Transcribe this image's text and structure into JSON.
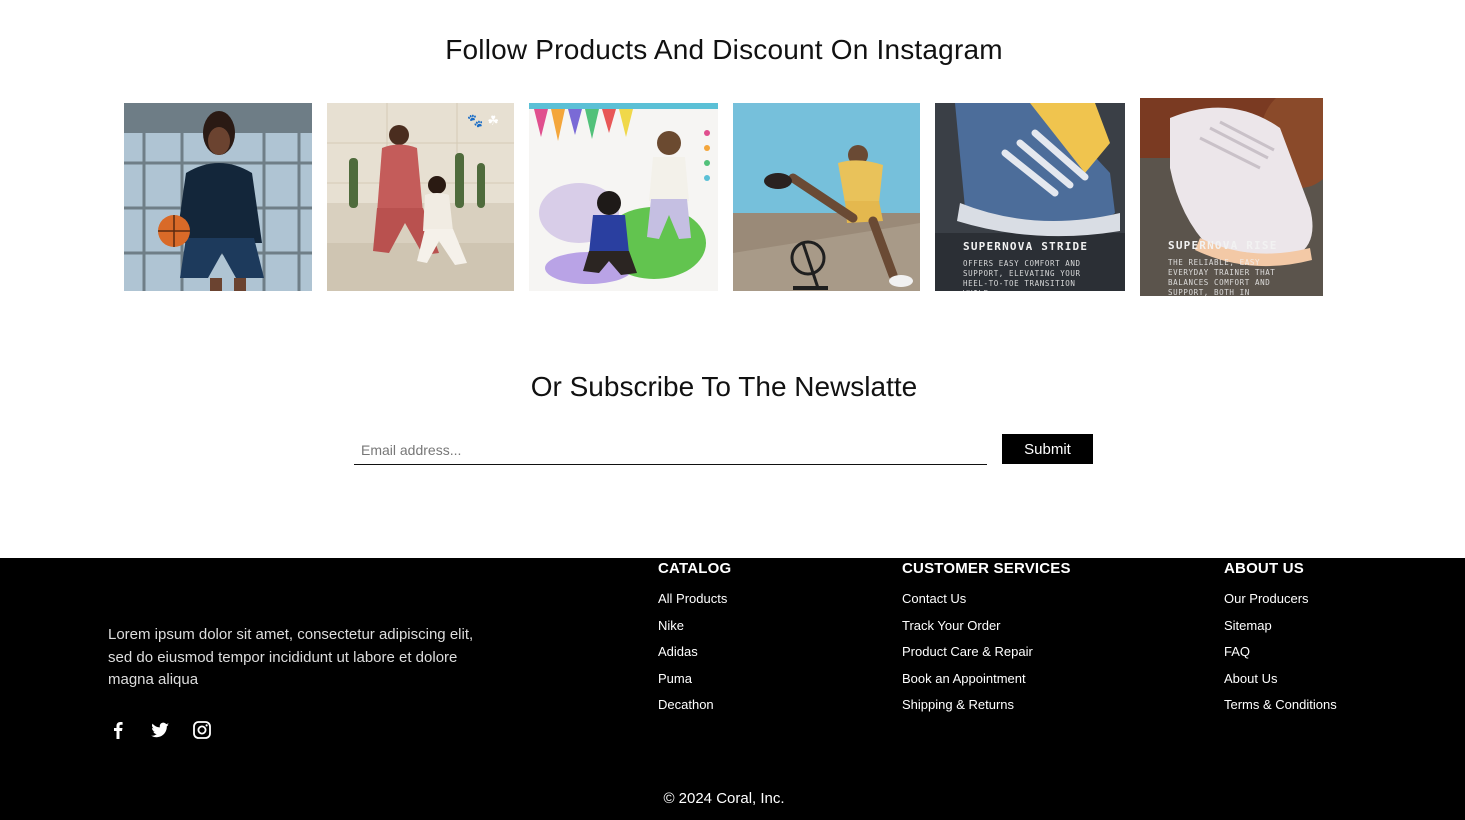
{
  "instagram": {
    "title": "Follow Products And Discount On Instagram",
    "posts": [
      {
        "name": "basketball-player"
      },
      {
        "name": "tracksuit-couple"
      },
      {
        "name": "kids-on-beanbag"
      },
      {
        "name": "athlete-kick"
      },
      {
        "name": "supernova-stride",
        "caption_title": "SUPERNOVA STRIDE",
        "caption_body": "OFFERS EASY COMFORT AND SUPPORT, ELEVATING YOUR HEEL-TO-TOE TRANSITION WHILE"
      },
      {
        "name": "supernova-rise",
        "caption_title": "SUPERNOVA RISE",
        "caption_body": "THE RELIABLE, EASY EVERYDAY TRAINER THAT BALANCES COMFORT AND SUPPORT, BOTH IN CUSHIONING AND FIT."
      }
    ]
  },
  "newsletter": {
    "title": "Or Subscribe To The Newslatte",
    "email_placeholder": "Email address...",
    "email_value": "",
    "submit_label": "Submit"
  },
  "footer": {
    "about_text": "Lorem ipsum dolor sit amet, consectetur adipiscing elit, sed do eiusmod tempor incididunt ut labore et dolore magna aliqua",
    "socials": [
      "facebook-icon",
      "twitter-icon",
      "instagram-icon"
    ],
    "columns": [
      {
        "title": "CATALOG",
        "links": [
          "All Products",
          "Nike",
          "Adidas",
          "Puma",
          "Decathon"
        ]
      },
      {
        "title": "CUSTOMER SERVICES",
        "links": [
          "Contact Us",
          "Track Your Order",
          "Product Care & Repair",
          "Book an Appointment",
          "Shipping & Returns"
        ]
      },
      {
        "title": "ABOUT US",
        "links": [
          "Our Producers",
          "Sitemap",
          "FAQ",
          "About Us",
          "Terms & Conditions"
        ]
      }
    ],
    "copyright": "© 2024 Coral, Inc."
  },
  "colors": {
    "footer_bg": "#000000",
    "button_bg": "#000000",
    "text": "#111111"
  }
}
